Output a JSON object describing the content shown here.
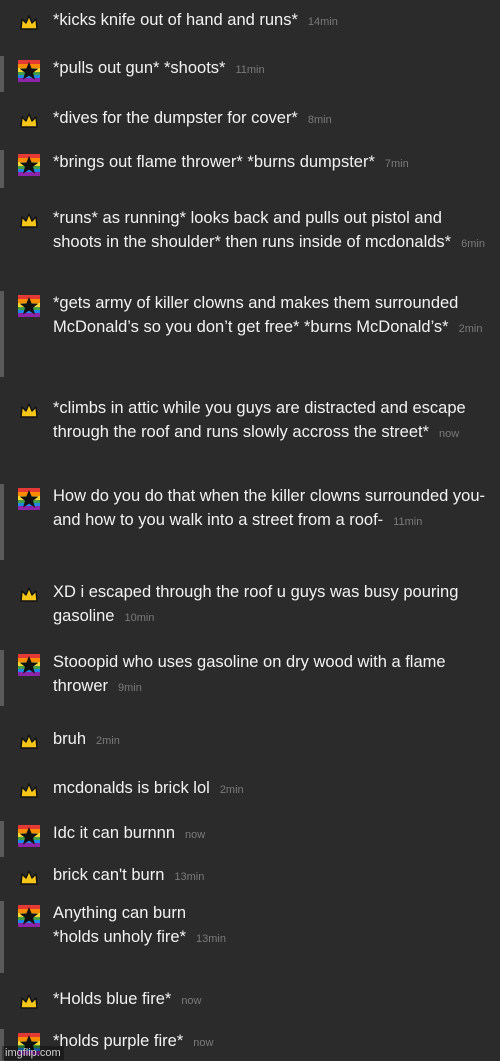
{
  "messages": [
    {
      "avatar": "crown",
      "text": "*kicks knife out of hand and runs*",
      "time": "14min"
    },
    {
      "avatar": "star",
      "text": "*pulls out gun* *shoots*",
      "time": "11min"
    },
    {
      "avatar": "crown",
      "text": "*dives for the dumpster for cover*",
      "time": "8min"
    },
    {
      "avatar": "star",
      "text": "*brings out flame thrower* *burns dumpster*",
      "time": "7min"
    },
    {
      "avatar": "crown",
      "text": "*runs* as running* looks back and pulls out pistol and shoots in the shoulder* then runs inside of mcdonalds*",
      "time": "6min"
    },
    {
      "avatar": "star",
      "text": "*gets army of killer clowns and makes them surrounded McDonald’s so you don’t get free* *burns McDonald’s*",
      "time": "2min"
    },
    {
      "avatar": "crown",
      "text": "*climbs in attic while you guys are distracted and escape through the roof and runs slowly accross the street*",
      "time": "now"
    },
    {
      "avatar": "star",
      "text": "How do you do that when the killer clowns surrounded you- and how to you walk into a street from a roof-",
      "time": "11min"
    },
    {
      "avatar": "crown",
      "text": "XD i escaped through the roof u guys was busy pouring gasoline",
      "time": "10min"
    },
    {
      "avatar": "star",
      "text": "Stooopid who uses gasoline on dry wood with a flame thrower",
      "time": "9min"
    },
    {
      "avatar": "crown",
      "text": "bruh",
      "time": "2min"
    },
    {
      "avatar": "crown",
      "text": "mcdonalds is brick lol",
      "time": "2min"
    },
    {
      "avatar": "star",
      "text": "Idc it can burnnn",
      "time": "now"
    },
    {
      "avatar": "crown",
      "text": "brick can't burn",
      "time": "13min"
    },
    {
      "avatar": "star",
      "text": "Anything can burn\n*holds unholy fire*",
      "time": "13min"
    },
    {
      "avatar": "crown",
      "text": "*Holds blue fire*",
      "time": "now"
    },
    {
      "avatar": "star",
      "text": "*holds purple fire*",
      "time": "now"
    }
  ],
  "watermark": "imgflip.com",
  "colors": {
    "background": "#2b2b2b",
    "text": "#f2f2f2",
    "timestamp": "#7a7a7a",
    "crown": "#f5c518",
    "star_bar": "#5a5a5a"
  }
}
